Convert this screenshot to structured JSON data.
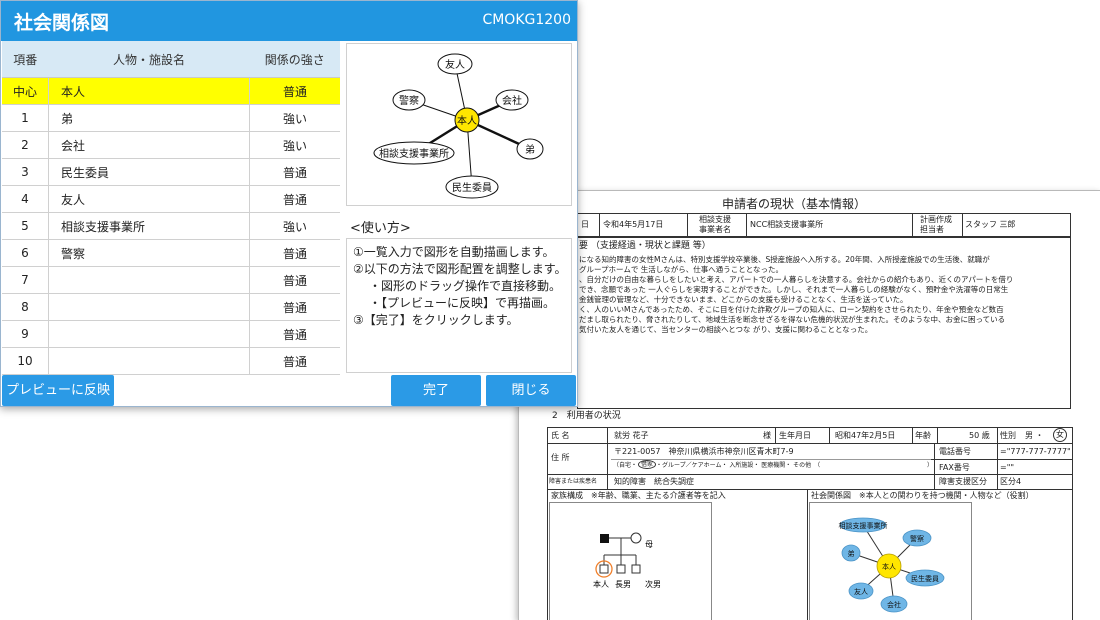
{
  "app": {
    "title": "社会関係図",
    "screen_code": "CMOKG1200",
    "table": {
      "headers": [
        "項番",
        "人物・施設名",
        "関係の強さ"
      ],
      "rows": [
        {
          "no": "中心",
          "name": "本人",
          "strength": "普通"
        },
        {
          "no": "1",
          "name": "弟",
          "strength": "強い"
        },
        {
          "no": "2",
          "name": "会社",
          "strength": "強い"
        },
        {
          "no": "3",
          "name": "民生委員",
          "strength": "普通"
        },
        {
          "no": "4",
          "name": "友人",
          "strength": "普通"
        },
        {
          "no": "5",
          "name": "相談支援事業所",
          "strength": "強い"
        },
        {
          "no": "6",
          "name": "警察",
          "strength": "普通"
        },
        {
          "no": "7",
          "name": "",
          "strength": "普通"
        },
        {
          "no": "8",
          "name": "",
          "strength": "普通"
        },
        {
          "no": "9",
          "name": "",
          "strength": "普通"
        },
        {
          "no": "10",
          "name": "",
          "strength": "普通"
        }
      ]
    },
    "diagram": {
      "center": "本人",
      "nodes": [
        "友人",
        "警察",
        "会社",
        "相談支援事業所",
        "弟",
        "民生委員"
      ]
    },
    "usage": {
      "title": "<使い方>",
      "lines": [
        "①一覧入力で図形を自動描画します。",
        "②以下の方法で図形配置を調整します。",
        "・図形のドラッグ操作で直接移動。",
        "・【プレビューに反映】で再描画。",
        "③【完了】をクリックします。"
      ]
    },
    "buttons": {
      "preview": "プレビューに反映",
      "done": "完了",
      "close": "閉じる"
    }
  },
  "document": {
    "title": "申請者の現状（基本情報）",
    "header": {
      "date_label": "日",
      "date_value": "令和4年5月17日",
      "agency_label_1": "相談支援",
      "agency_label_2": "事業者名",
      "agency_value": "NCC相談支援事業所",
      "planner_label_1": "計画作成",
      "planner_label_2": "担当者",
      "planner_value": "スタッフ 三郎"
    },
    "summary_title": "要 （支援経過・現状と課題 等）",
    "summary_lines": [
      "になる知的障害の女性Mさんは、特別支援学校卒業後、S授産施設へ入所する。20年間、入所授産施設での生活後、就職が",
      "グループホームで 生活しながら、仕事へ通うこととなった。",
      "、自分だけの自由な暮らしをしたいと考え、アパートでの一人暮らしを決意する。会社からの紹介もあり、近くのアパートを借り",
      "でき、念願であった 一人ぐらしを実現することができた。しかし、それまで一人暮らしの経験がなく、預貯金や洗濯等の日常生",
      "金銭管理の管理など、十分できないまま、どこからの支援も受けることなく、生活を送っていた。",
      "く、人のいいMさんであったため、そこに目を付けた詐欺グループの知人に、ローン契約をさせられたり、年金や預金など数百",
      "だまし取られたり、脅されたりして、地域生活を断念せざるを得ない危機的状況が生まれた。そのような中、お金に困っている",
      "気付いた友人を通じて、当センターの相談へとつな がり、支援に関わることとなった。"
    ],
    "user_section_title": "2　利用者の状況",
    "name_label": "氏 名",
    "name_value": "就労 花子",
    "honorific": "様",
    "birth_label": "生年月日",
    "birth_value": "昭和47年2月5日",
    "age_label": "年齢",
    "age_value": "50 歳",
    "sex_label": "性別",
    "sex_value": "男 ・",
    "sex_female": "女",
    "address_label": "住 所",
    "address_value": "〒221-0057　神奈川県横浜市神奈川区青木町7-9",
    "address_options": "（自宅・",
    "address_circled": "借家",
    "address_options_rest": "・グループ／ケアホーム・ 入所施設・ 医療機関・ その他　（",
    "address_close": "）",
    "phone_label": "電話番号",
    "phone_value": "=\"777-777-7777\"",
    "fax_label": "FAX番号",
    "fax_value": "=\"\"",
    "disability_label": "障害または疾患名",
    "disability_value": "知的障害　統合失調症",
    "support_label": "障害支援区分",
    "support_value": "区分4",
    "family_title": "家族構成　※年齢、職業、主たる介護者等を記入",
    "family_labels": {
      "mother": "母",
      "self": "本人",
      "eldest": "長男",
      "second": "次男"
    },
    "social_title": "社会関係図　※本人との関わりを持つ機関・人物など（役割）",
    "social_nodes": {
      "center": "本人",
      "consult": "相談支援事業所",
      "police": "警察",
      "brother": "弟",
      "welfare": "民生委員",
      "friend": "友人",
      "company": "会社"
    }
  },
  "colors": {
    "title_bar": "#2196e0",
    "button": "#2b9ae6",
    "highlight_row": "#ffff00",
    "center_node": "#ffe600",
    "doc_node": "#6fb6e6"
  }
}
